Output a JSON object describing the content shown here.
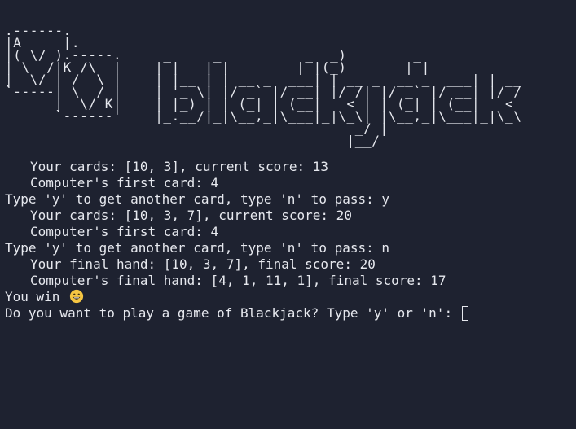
{
  "ascii_logo": ".------.\n|A_  _ |.                                _\n|( \\/ ).-----.     _     _          _  _)        _\n| \\  /|K /\\  |    | |   | |        | |(_)       | |\n|  \\/ | /  \\ |    | |__ | | __ _  ___| | __ _  __ _  ___| | __\n`-----| \\  / |    | '_ \\| |/ _` |/ __| |/ /| |/ _` |/ __| |/ /\n      |  \\/ K|    | |_) | | (_| | (__|   < | | (_| | (__|   <\n      `------'    |_.__/|_|\\__,_|\\___|_|\\_\\| |\\__,_|\\___|_|\\_\\\n                                          _/ |\n                                         |__/",
  "lines": [
    {
      "text": "Your cards: [10, 3], current score: 13",
      "indent": true
    },
    {
      "text": "Computer's first card: 4",
      "indent": true
    },
    {
      "text": "Type 'y' to get another card, type 'n' to pass: y",
      "indent": false
    },
    {
      "text": "Your cards: [10, 3, 7], current score: 20",
      "indent": true
    },
    {
      "text": "Computer's first card: 4",
      "indent": true
    },
    {
      "text": "Type 'y' to get another card, type 'n' to pass: n",
      "indent": false
    },
    {
      "text": "Your final hand: [10, 3, 7], final score: 20",
      "indent": true
    },
    {
      "text": "Computer's final hand: [4, 1, 11, 1], final score: 17",
      "indent": true
    },
    {
      "text": "You win",
      "indent": false,
      "icon": "grinning-face-emoji"
    }
  ],
  "prompt": {
    "text": "Do you want to play a game of Blackjack? Type 'y' or 'n': ",
    "input_value": ""
  },
  "colors": {
    "background": "#1e2230",
    "foreground": "#e6e8ee",
    "emoji": "#f5c542"
  }
}
